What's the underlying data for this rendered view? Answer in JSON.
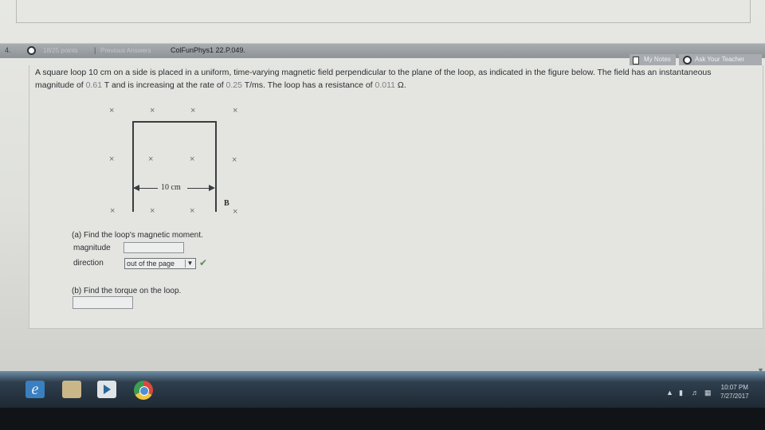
{
  "question": {
    "number": "4.",
    "points": "18/25 points",
    "separator": "|",
    "previous_answers": "Previous Answers",
    "problem_id": "ColFunPhys1 22.P.049."
  },
  "toolbar": {
    "my_notes": "My Notes",
    "ask_teacher": "Ask Your Teacher"
  },
  "problem": {
    "part1": "A square loop 10 cm on a side is placed in a uniform, time-varying magnetic field perpendicular to the plane of the loop, as indicated in the figure below. The field has an instantaneous magnitude of ",
    "field_value": "0.61",
    "part2": " T and is increasing at the rate of ",
    "rate_value": "0.25",
    "part3": " T/ms. The loop has a resistance of ",
    "resistance_value": "0.011",
    "part4": " Ω."
  },
  "figure": {
    "x_mark": "×",
    "dimension_label": "10 cm",
    "field_label": "B"
  },
  "part_a": {
    "prompt": "(a) Find the loop's magnetic moment.",
    "magnitude_label": "magnitude",
    "magnitude_value": "",
    "direction_label": "direction",
    "direction_selected": "out of the page",
    "status": "correct"
  },
  "part_b": {
    "prompt": "(b) Find the torque on the loop.",
    "answer_value": ""
  },
  "taskbar": {
    "apps": [
      "internet-explorer",
      "file-explorer",
      "media-player",
      "chrome"
    ],
    "time": "10:07 PM",
    "date": "7/27/2017"
  },
  "colors": {
    "accent_value": "#7d8186",
    "check_green": "#5e8a5c",
    "taskbar": "#1e2933"
  }
}
